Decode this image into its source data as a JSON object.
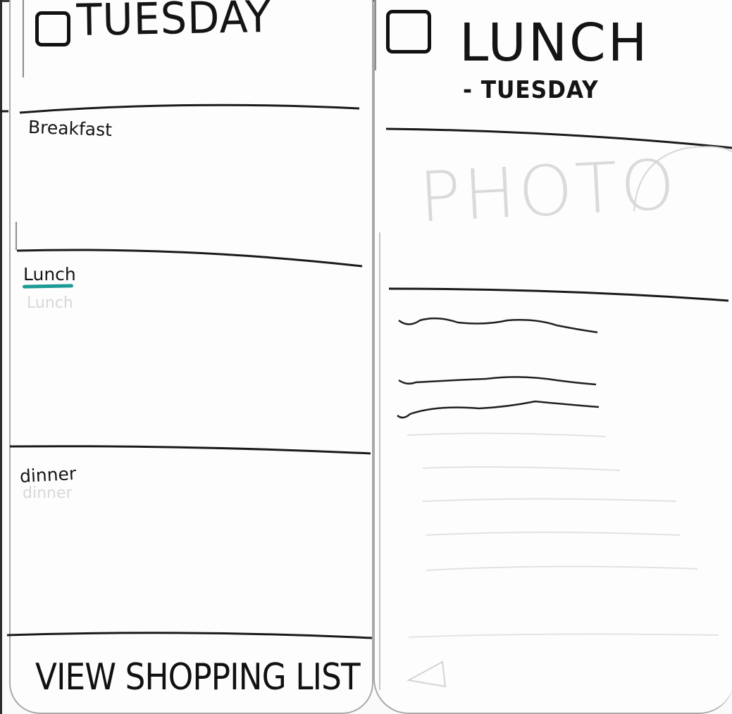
{
  "day_screen": {
    "title": "TUESDAY",
    "meals": [
      {
        "label": "Breakfast"
      },
      {
        "label": "Lunch"
      },
      {
        "label": "dinner"
      }
    ],
    "shopping_button": "VIEW SHOPPING LIST"
  },
  "meal_screen": {
    "title": "LUNCH",
    "subtitle": "- TUESDAY",
    "photo_placeholder": "PHOTO"
  },
  "colors": {
    "ink": "#141414",
    "highlight": "#1b9a96",
    "frame": "#a9a9ab",
    "pencil_ghost": "#d8d8dc"
  },
  "icons": {
    "day_checkbox": "checkbox-icon",
    "meal_checkbox": "checkbox-icon",
    "back": "back-arrow-icon"
  }
}
